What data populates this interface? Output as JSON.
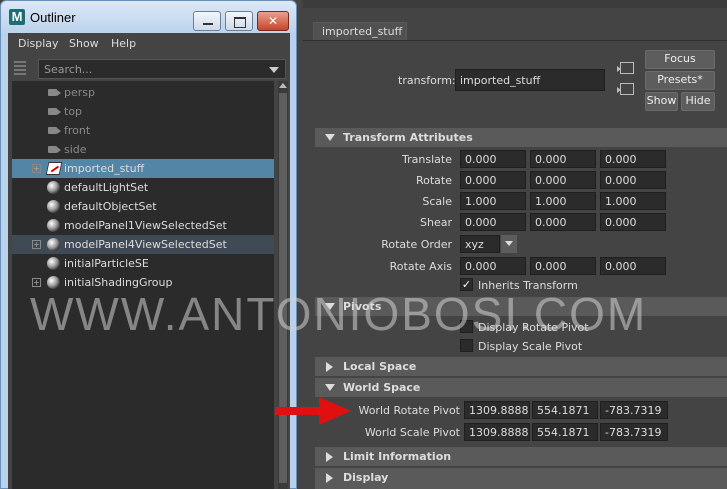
{
  "outliner": {
    "title": "Outliner",
    "menus": [
      "Display",
      "Show",
      "Help"
    ],
    "search_placeholder": "Search...",
    "items": [
      {
        "label": "persp",
        "kind": "camera"
      },
      {
        "label": "top",
        "kind": "camera"
      },
      {
        "label": "front",
        "kind": "camera"
      },
      {
        "label": "side",
        "kind": "camera"
      },
      {
        "label": "imported_stuff",
        "kind": "transform",
        "selected": true
      },
      {
        "label": "defaultLightSet",
        "kind": "set"
      },
      {
        "label": "defaultObjectSet",
        "kind": "set"
      },
      {
        "label": "modelPanel1ViewSelectedSet",
        "kind": "set"
      },
      {
        "label": "modelPanel4ViewSelectedSet",
        "kind": "set"
      },
      {
        "label": "initialParticleSE",
        "kind": "set"
      },
      {
        "label": "initialShadingGroup",
        "kind": "set"
      }
    ]
  },
  "attribute_editor": {
    "tab": "imported_stuff",
    "transform_label": "transform:",
    "transform_value": "imported_stuff",
    "focus_label": "Focus",
    "presets_label": "Presets*",
    "show_label": "Show",
    "hide_label": "Hide",
    "transform_attributes": {
      "title": "Transform Attributes",
      "translate_label": "Translate",
      "translate": [
        "0.000",
        "0.000",
        "0.000"
      ],
      "rotate_label": "Rotate",
      "rotate": [
        "0.000",
        "0.000",
        "0.000"
      ],
      "scale_label": "Scale",
      "scale": [
        "1.000",
        "1.000",
        "1.000"
      ],
      "shear_label": "Shear",
      "shear": [
        "0.000",
        "0.000",
        "0.000"
      ],
      "rotate_order_label": "Rotate Order",
      "rotate_order": "xyz",
      "rotate_axis_label": "Rotate Axis",
      "rotate_axis": [
        "0.000",
        "0.000",
        "0.000"
      ],
      "inherits_transform_label": "Inherits Transform",
      "inherits_transform_check": "✓"
    },
    "pivots": {
      "title": "Pivots",
      "display_rotate_pivot": "Display Rotate Pivot",
      "display_scale_pivot": "Display Scale Pivot"
    },
    "local_space": {
      "title": "Local Space"
    },
    "world_space": {
      "title": "World Space",
      "rotate_pivot_label": "World Rotate Pivot",
      "rotate_pivot": [
        "1309.8888",
        "554.1871",
        "-783.7319"
      ],
      "scale_pivot_label": "World Scale Pivot",
      "scale_pivot": [
        "1309.8888",
        "554.1871",
        "-783.7319"
      ]
    },
    "limit_information": {
      "title": "Limit Information"
    },
    "display": {
      "title": "Display"
    }
  },
  "watermark": "WWW.ANTONIOBOSI.COM",
  "colors": {
    "selection": "#5285a6",
    "panel_bg": "#444444",
    "field_bg": "#2b2b2b",
    "arrow": "#e01010"
  },
  "icons": {
    "app": "maya-icon",
    "camera": "camera-icon",
    "set": "set-sphere-icon",
    "transform": "transform-icon"
  }
}
